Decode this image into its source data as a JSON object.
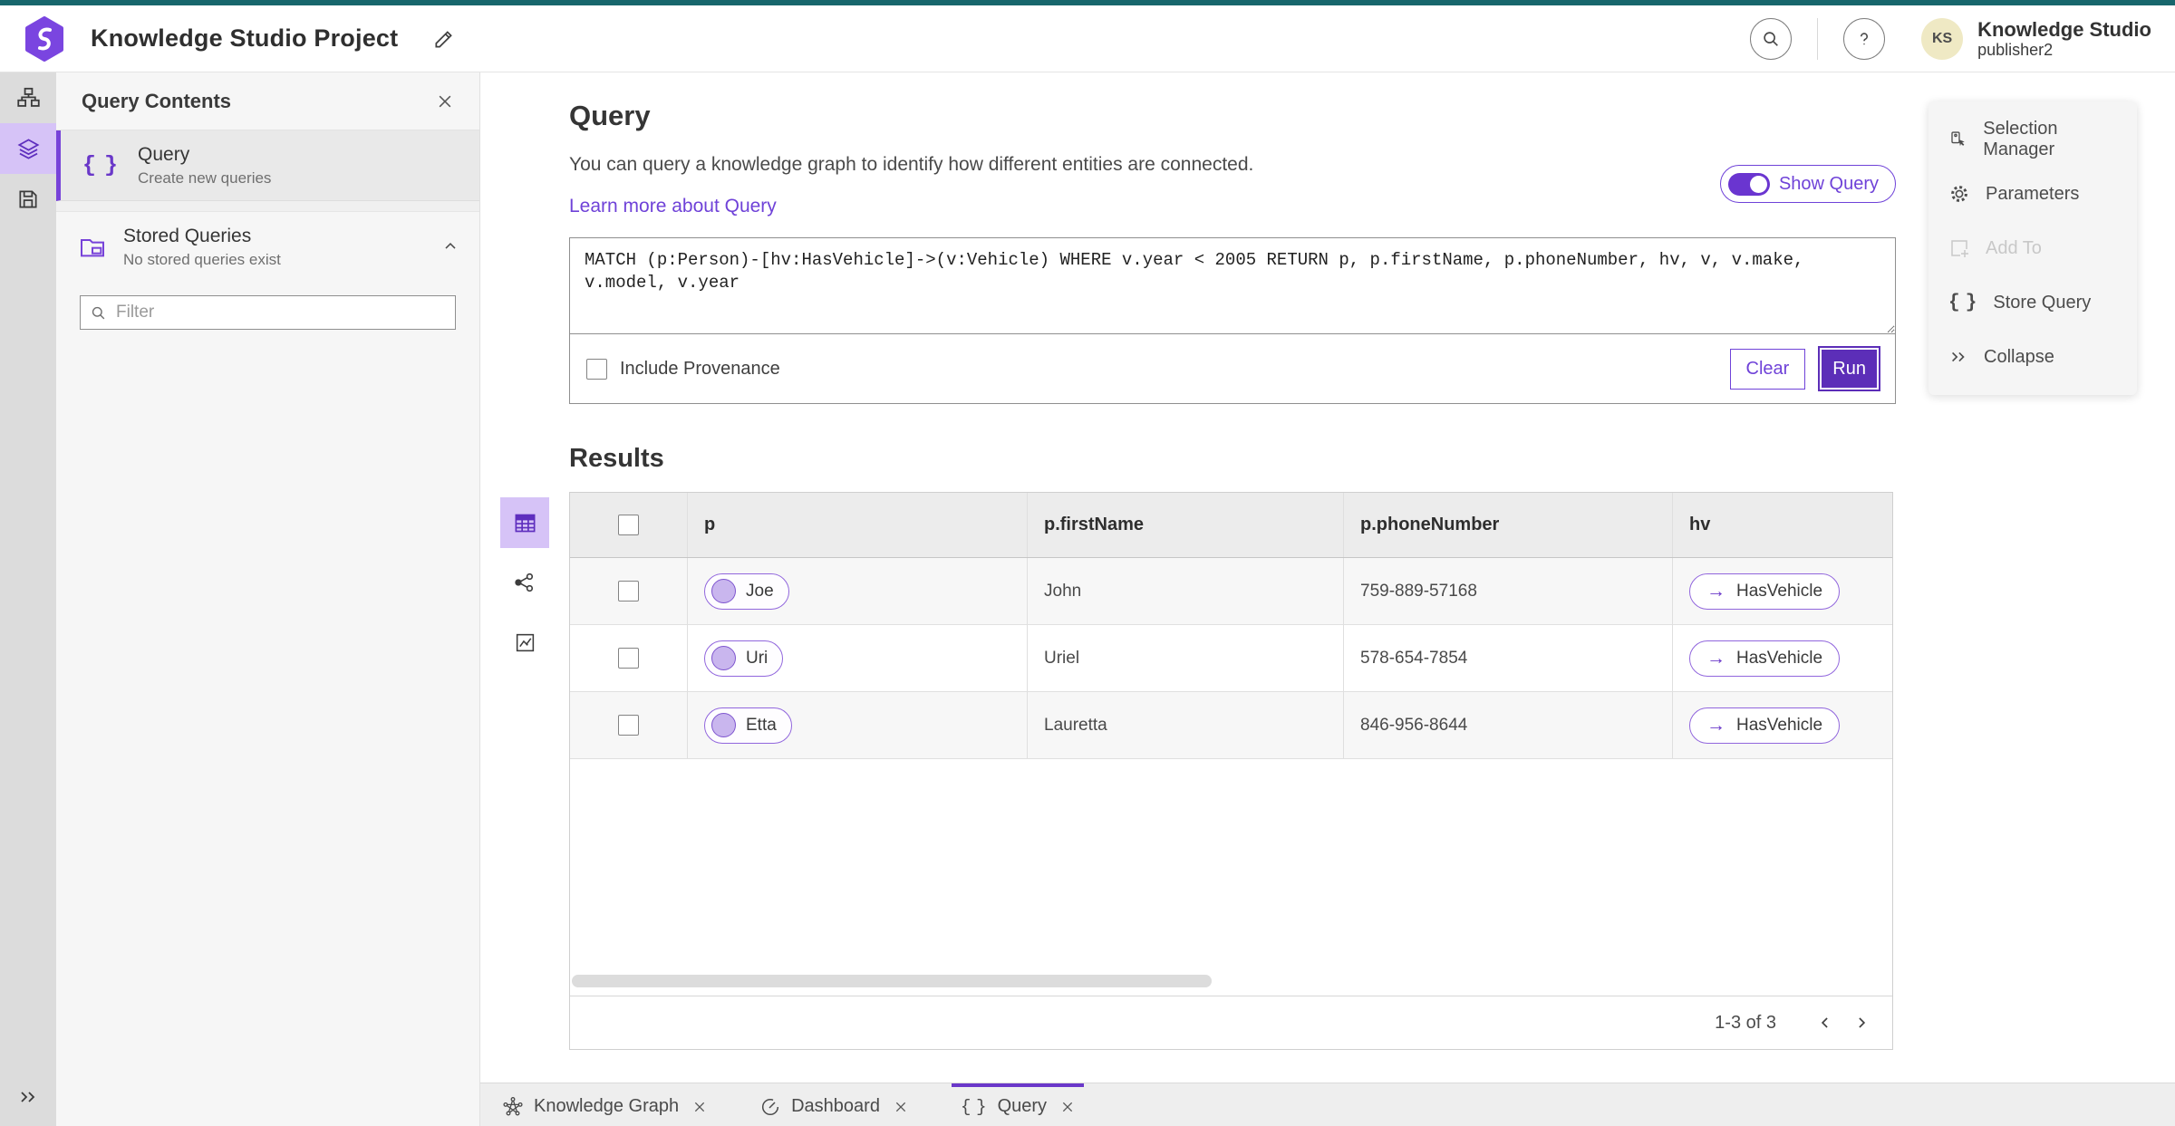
{
  "header": {
    "title": "Knowledge Studio Project",
    "product": "Knowledge Studio",
    "user": "publisher2",
    "avatar_initials": "KS"
  },
  "sidebar": {
    "title": "Query Contents",
    "query_item": {
      "label": "Query",
      "description": "Create new queries"
    },
    "stored": {
      "label": "Stored Queries",
      "description": "No stored queries exist"
    },
    "filter_placeholder": "Filter"
  },
  "query_section": {
    "title": "Query",
    "description": "You can query a knowledge graph to identify how different entities are connected.",
    "link": "Learn more about Query",
    "toggle_label": "Show Query",
    "query_text": "MATCH (p:Person)-[hv:HasVehicle]->(v:Vehicle) WHERE v.year < 2005 RETURN p, p.firstName, p.phoneNumber, hv, v, v.make, v.model, v.year",
    "include_provenance_label": "Include Provenance",
    "clear_label": "Clear",
    "run_label": "Run"
  },
  "results": {
    "title": "Results",
    "columns": [
      "p",
      "p.firstName",
      "p.phoneNumber",
      "hv"
    ],
    "rows": [
      {
        "p": "Joe",
        "firstName": "John",
        "phoneNumber": "759-889-57168",
        "hv": "HasVehicle"
      },
      {
        "p": "Uri",
        "firstName": "Uriel",
        "phoneNumber": "578-654-7854",
        "hv": "HasVehicle"
      },
      {
        "p": "Etta",
        "firstName": "Lauretta",
        "phoneNumber": "846-956-8644",
        "hv": "HasVehicle"
      }
    ],
    "pagination": "1-3 of 3",
    "arrow_glyph": "→"
  },
  "tools_panel": {
    "items": [
      {
        "label": "Selection Manager"
      },
      {
        "label": "Parameters"
      },
      {
        "label": "Add To"
      },
      {
        "label": "Store Query"
      },
      {
        "label": "Collapse"
      }
    ]
  },
  "bottom_tabs": [
    {
      "label": "Knowledge Graph"
    },
    {
      "label": "Dashboard"
    },
    {
      "label": "Query"
    }
  ],
  "icons": [
    "search-icon",
    "help-icon",
    "edit-pencil-icon",
    "data-model-icon",
    "layers-icon",
    "save-icon",
    "close-icon",
    "braces-icon",
    "folder-icon",
    "chevron-up-icon",
    "table-view-icon",
    "graph-view-icon",
    "chart-view-icon",
    "selection-manager-icon",
    "gear-icon",
    "add-to-icon",
    "collapse-icon",
    "knowledge-graph-icon",
    "dashboard-icon"
  ],
  "colors": {
    "accent_purple": "#6a38c9",
    "run_button": "#5c2eb8",
    "active_highlight": "#d6c3f7",
    "top_bar_teal": "#17666c",
    "avatar_bg": "#efe9c4",
    "rail_bg": "#dcdcdc",
    "panel_bg": "#f6f6f6",
    "table_header_bg": "#ececec",
    "row_alt_bg": "#f7f7f7"
  }
}
